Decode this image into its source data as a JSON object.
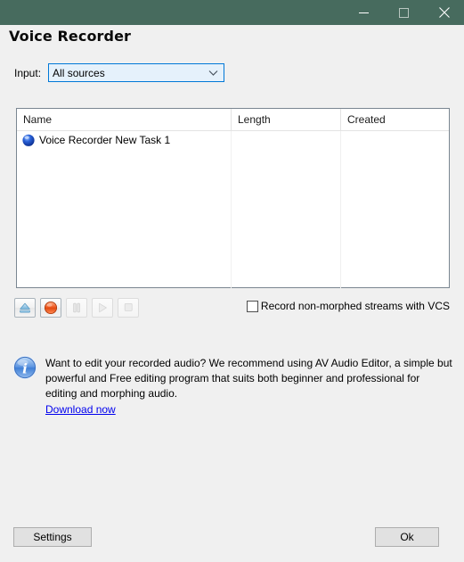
{
  "window": {
    "titlebar": {
      "background": "#476b5e",
      "controls": [
        {
          "name": "minimize",
          "label": "–"
        },
        {
          "name": "maximize",
          "label": "☐"
        },
        {
          "name": "close",
          "label": "✕"
        }
      ]
    }
  },
  "page": {
    "title": "Voice Recorder"
  },
  "input": {
    "label": "Input:",
    "value": "All sources",
    "options": [
      "All sources"
    ],
    "chevron_icon": "chevron-down-icon",
    "border_color": "#0078d7",
    "fill_color": "#e5f1fb"
  },
  "list": {
    "columns": [
      {
        "key": "name",
        "label": "Name"
      },
      {
        "key": "length",
        "label": "Length"
      },
      {
        "key": "created",
        "label": "Created"
      }
    ],
    "rows": [
      {
        "icon": "blue-sphere-icon",
        "name": "Voice Recorder New Task 1",
        "length": "",
        "created": ""
      }
    ]
  },
  "toolbar": {
    "buttons": [
      {
        "name": "eject-button",
        "icon": "eject-icon",
        "enabled": true,
        "tooltip": "Eject"
      },
      {
        "name": "record-button",
        "icon": "record-icon",
        "enabled": true,
        "tooltip": "Record"
      },
      {
        "name": "pause-button",
        "icon": "pause-icon",
        "enabled": false,
        "tooltip": "Pause"
      },
      {
        "name": "play-button",
        "icon": "play-icon",
        "enabled": false,
        "tooltip": "Play"
      },
      {
        "name": "stop-button",
        "icon": "stop-icon",
        "enabled": false,
        "tooltip": "Stop"
      }
    ]
  },
  "options": {
    "record_non_morphed": {
      "label": "Record non-morphed streams with VCS",
      "checked": false
    }
  },
  "info": {
    "icon": "info-icon",
    "text": "Want to edit your recorded audio? We recommend using AV Audio Editor, a simple but powerful and Free editing program that suits both beginner and professional for editing and morphing audio.",
    "link_label": "Download now",
    "link_color": "#0000ee"
  },
  "footer": {
    "settings_label": "Settings",
    "ok_label": "Ok"
  }
}
